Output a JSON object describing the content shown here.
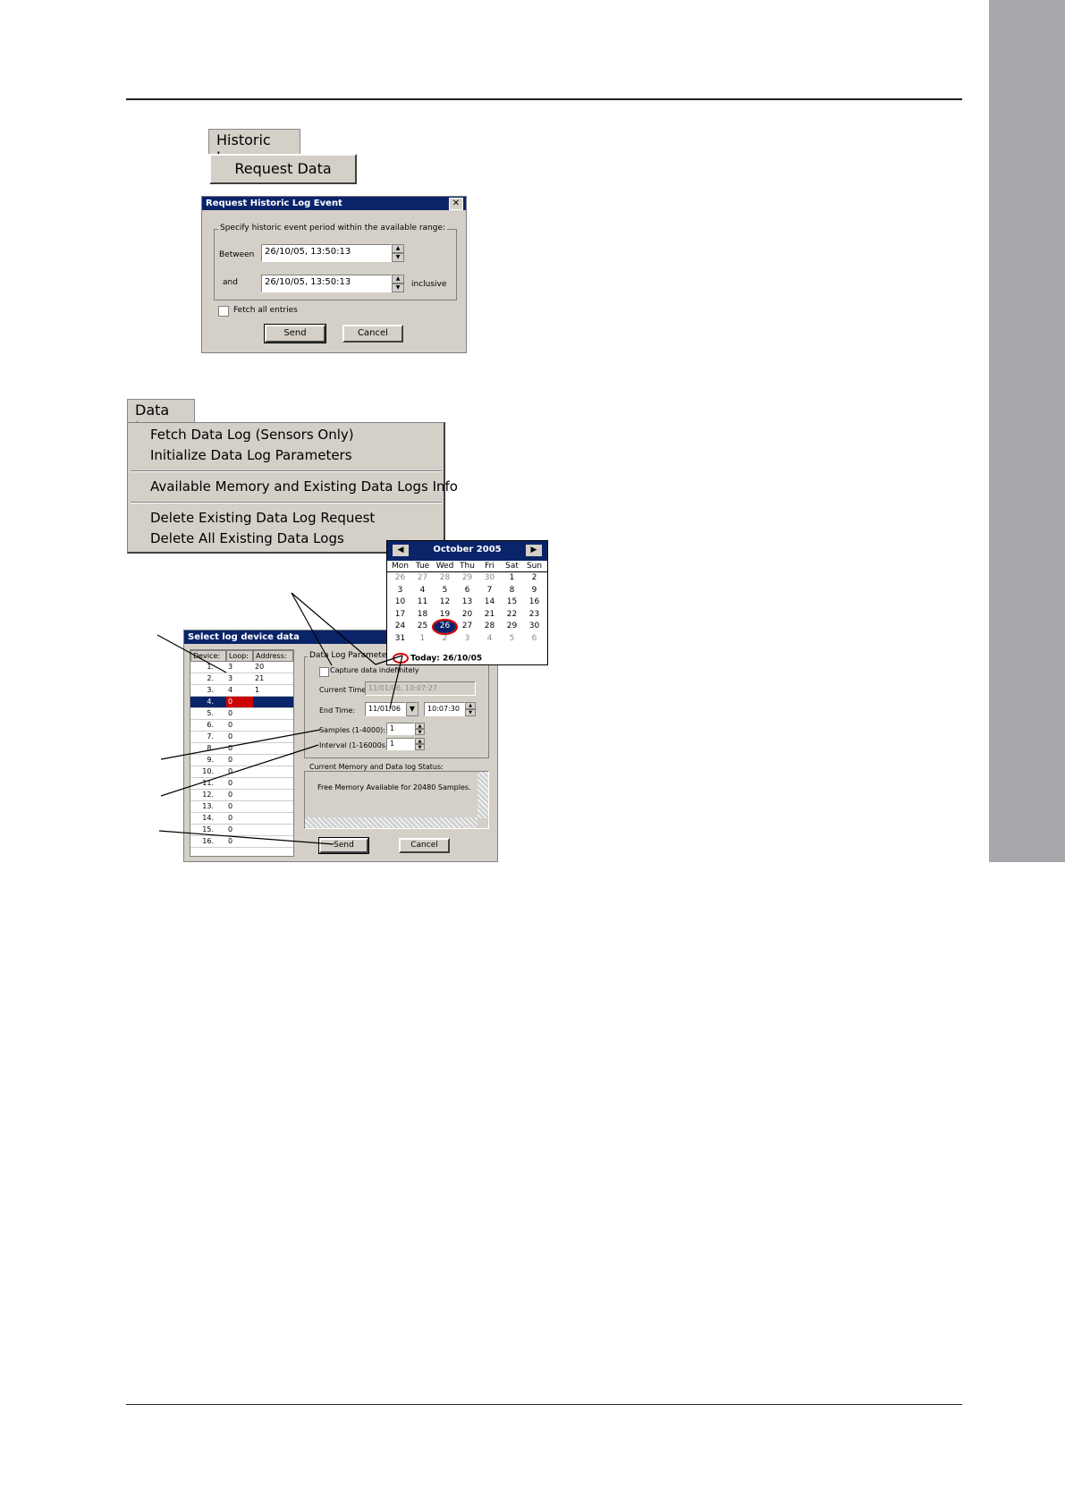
{
  "historic_log": {
    "menu_tab": "Historic Log",
    "request_button": "Request Data",
    "dialog": {
      "title": "Request Historic Log Event",
      "group_label": "Specify historic event period within the available range:",
      "between_label": "Between",
      "between_value": "26/10/05, 13:50:13",
      "and_label": "and",
      "and_value": "26/10/05, 13:50:13",
      "inclusive_label": "inclusive",
      "fetch_all_label": "Fetch all entries",
      "send_label": "Send",
      "cancel_label": "Cancel"
    }
  },
  "data_log": {
    "menu_tab": "Data Log",
    "items": [
      "Fetch Data Log (Sensors Only)",
      "Initialize Data Log Parameters",
      "Available Memory and Existing Data Logs Info",
      "Delete Existing Data Log Request",
      "Delete All Existing Data Logs"
    ]
  },
  "calendar": {
    "month_label": "October 2005",
    "weekdays": [
      "Mon",
      "Tue",
      "Wed",
      "Thu",
      "Fri",
      "Sat",
      "Sun"
    ],
    "weeks": [
      [
        "26",
        "27",
        "28",
        "29",
        "30",
        "1",
        "2"
      ],
      [
        "3",
        "4",
        "5",
        "6",
        "7",
        "8",
        "9"
      ],
      [
        "10",
        "11",
        "12",
        "13",
        "14",
        "15",
        "16"
      ],
      [
        "17",
        "18",
        "19",
        "20",
        "21",
        "22",
        "23"
      ],
      [
        "24",
        "25",
        "26",
        "27",
        "28",
        "29",
        "30"
      ],
      [
        "31",
        "1",
        "2",
        "3",
        "4",
        "5",
        "6"
      ]
    ],
    "today_label": "Today: 26/10/05"
  },
  "log_device_dialog": {
    "title": "Select log device data",
    "columns": [
      "Device:",
      "Loop:",
      "Address:"
    ],
    "rows": [
      [
        "1.",
        "3",
        "20"
      ],
      [
        "2.",
        "3",
        "21"
      ],
      [
        "3.",
        "4",
        "1"
      ],
      [
        "4.",
        "0",
        ""
      ],
      [
        "5.",
        "0",
        ""
      ],
      [
        "6.",
        "0",
        ""
      ],
      [
        "7.",
        "0",
        ""
      ],
      [
        "8.",
        "0",
        ""
      ],
      [
        "9.",
        "0",
        ""
      ],
      [
        "10.",
        "0",
        ""
      ],
      [
        "11.",
        "0",
        ""
      ],
      [
        "12.",
        "0",
        ""
      ],
      [
        "13.",
        "0",
        ""
      ],
      [
        "14.",
        "0",
        ""
      ],
      [
        "15.",
        "0",
        ""
      ],
      [
        "16.",
        "0",
        ""
      ]
    ],
    "params_group": "Data Log Parameters:",
    "capture_label": "Capture data indefinitely",
    "current_time_label": "Current Time:",
    "current_time_value": "11/01/06, 10:07:27",
    "end_time_label": "End Time:",
    "end_date_value": "11/01/06",
    "end_time_value": "10:07:30",
    "samples_label": "Samples (1-4000):",
    "samples_value": "1",
    "interval_label": "Interval (1-16000s):",
    "interval_value": "1",
    "memory_group": "Current Memory and Data log Status:",
    "memory_text": "Free Memory Available for 20480 Samples.",
    "send_label": "Send",
    "cancel_label": "Cancel"
  }
}
